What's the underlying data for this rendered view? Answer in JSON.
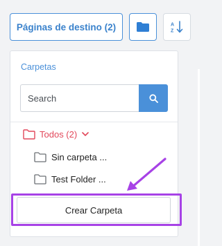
{
  "toolbar": {
    "pages_button_label": "Páginas de destino (2)",
    "folder_icon": "folder-icon",
    "sort_icon": "sort-alpha-down-icon",
    "sort_glyph_a": "A",
    "sort_glyph_z": "Z"
  },
  "panel": {
    "title": "Carpetas",
    "search": {
      "placeholder": "Search",
      "value": "",
      "button_icon": "search-icon"
    },
    "tree": {
      "root": {
        "label": "Todos (2)",
        "icon": "folder-outline-icon",
        "expand_icon": "chevron-down-icon"
      },
      "items": [
        {
          "label": "Sin carpeta ...",
          "icon": "folder-outline-icon"
        },
        {
          "label": "Test Folder ...",
          "icon": "folder-outline-icon"
        }
      ]
    },
    "create_button_label": "Crear Carpeta"
  },
  "annotations": {
    "highlight_color": "#a742e6",
    "arrow_color": "#a742e6"
  },
  "colors": {
    "accent": "#4a90d9",
    "root_folder": "#e2475a"
  }
}
